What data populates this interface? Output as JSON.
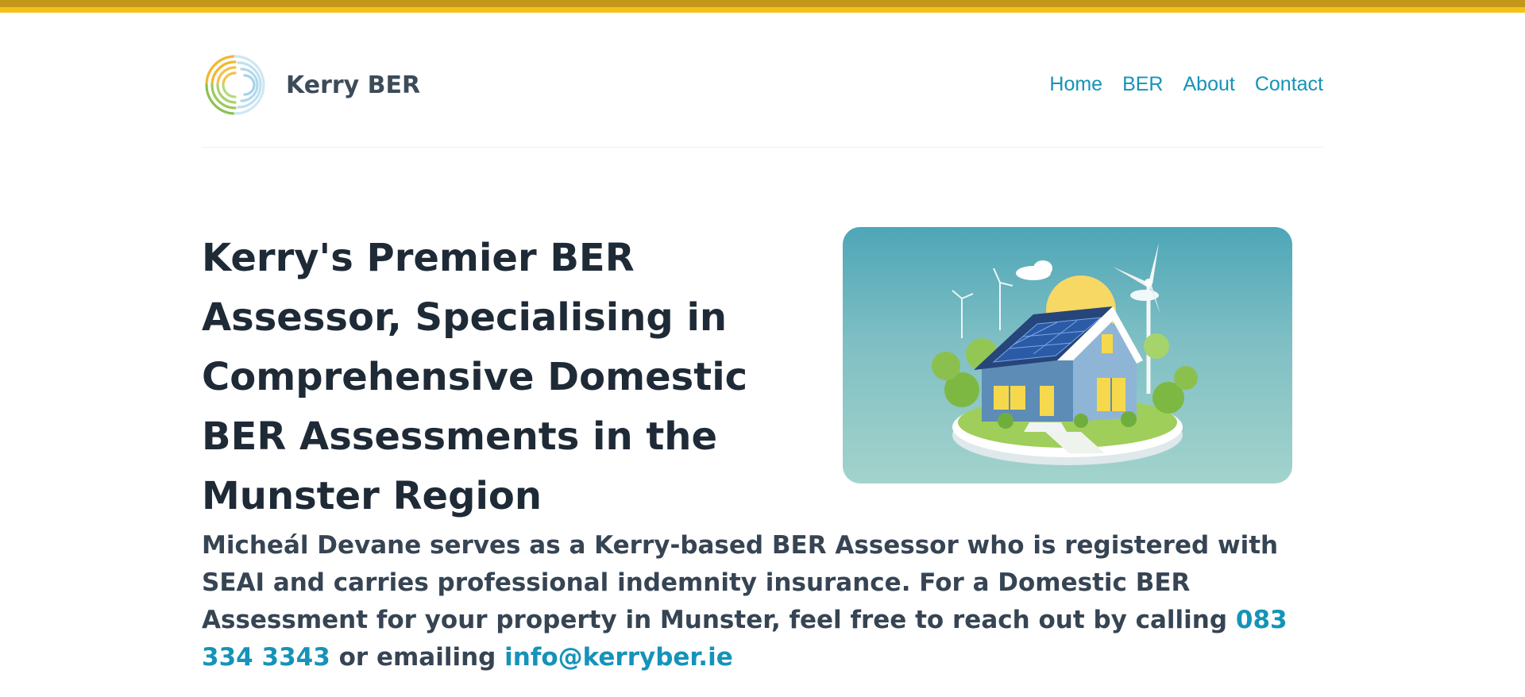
{
  "header": {
    "brand_name": "Kerry BER",
    "logo_icon": "concentric-arcs-logo-icon",
    "nav": [
      {
        "label": "Home"
      },
      {
        "label": "BER"
      },
      {
        "label": "About"
      },
      {
        "label": "Contact"
      }
    ]
  },
  "hero": {
    "title": "Kerry's Premier BER Assessor, Specialising in Comprehensive Domestic BER Assessments in the Munster Region",
    "image_icon": "eco-house-solar-wind-illustration-icon"
  },
  "intro": {
    "text_before_phone": "Micheál Devane serves as a Kerry-based BER Assessor who is registered with SEAI and carries professional indemnity insurance. For a Domestic BER Assessment for your property in Munster, feel free to reach out by calling ",
    "phone": "083 334 3343",
    "text_between": " or emailing ",
    "email": "info@kerryber.ie"
  },
  "colors": {
    "accent_yellow": "#f2c21b",
    "link_blue": "#1593b8",
    "heading": "#1f2a37",
    "body_text": "#364453"
  }
}
